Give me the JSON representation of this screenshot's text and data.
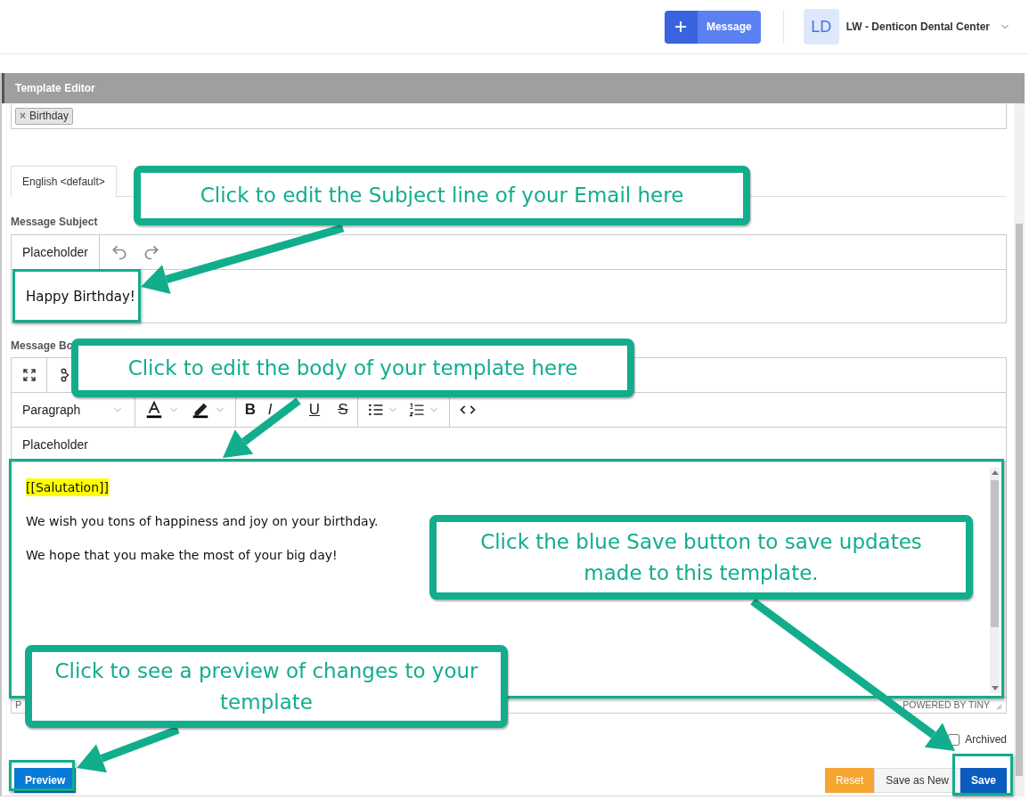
{
  "header": {
    "new_button": {
      "label": "Message"
    },
    "account": {
      "avatar": "LD",
      "name": "LW - Denticon Dental Center"
    }
  },
  "panel": {
    "title": "Template Editor",
    "tags": [
      {
        "remove": "×",
        "label": "Birthday"
      }
    ],
    "tabs": [
      {
        "label": "English <default>",
        "selected": true
      }
    ],
    "subject": {
      "label": "Message Subject",
      "menu": "Placeholder",
      "value": "Happy Birthday!"
    },
    "body": {
      "label": "Message Bo",
      "format": "Paragraph",
      "format_buttons": [
        {
          "kind": "bold",
          "label": "B"
        },
        {
          "kind": "italic",
          "label": "I"
        },
        {
          "kind": "underline",
          "label": "U"
        },
        {
          "kind": "strike",
          "label": "S"
        }
      ],
      "menu": "Placeholder",
      "paragraphs": [
        {
          "text": "[[Salutation]]",
          "highlighted": true
        },
        {
          "text": "We wish you tons of happiness and joy on your birthday.",
          "highlighted": false
        },
        {
          "text": "We hope that you make the most of your big day!",
          "highlighted": false
        }
      ],
      "status": "P",
      "branding": "POWERED BY TINY"
    },
    "archived": {
      "label": "Archived",
      "checked": false
    },
    "buttons": [
      {
        "label": "Preview",
        "kind": "primary"
      },
      {
        "label": "Reset",
        "kind": "warning"
      },
      {
        "label": "Save as New",
        "kind": "plain"
      },
      {
        "label": "Save",
        "kind": "dark"
      }
    ]
  },
  "callouts": [
    {
      "text": "Click to edit the Subject line of your Email here"
    },
    {
      "text": "Click to edit the body of your template here"
    },
    {
      "text": "Click the blue Save button to save updates made to this template."
    },
    {
      "text": "Click to see a preview of changes to your template"
    }
  ]
}
